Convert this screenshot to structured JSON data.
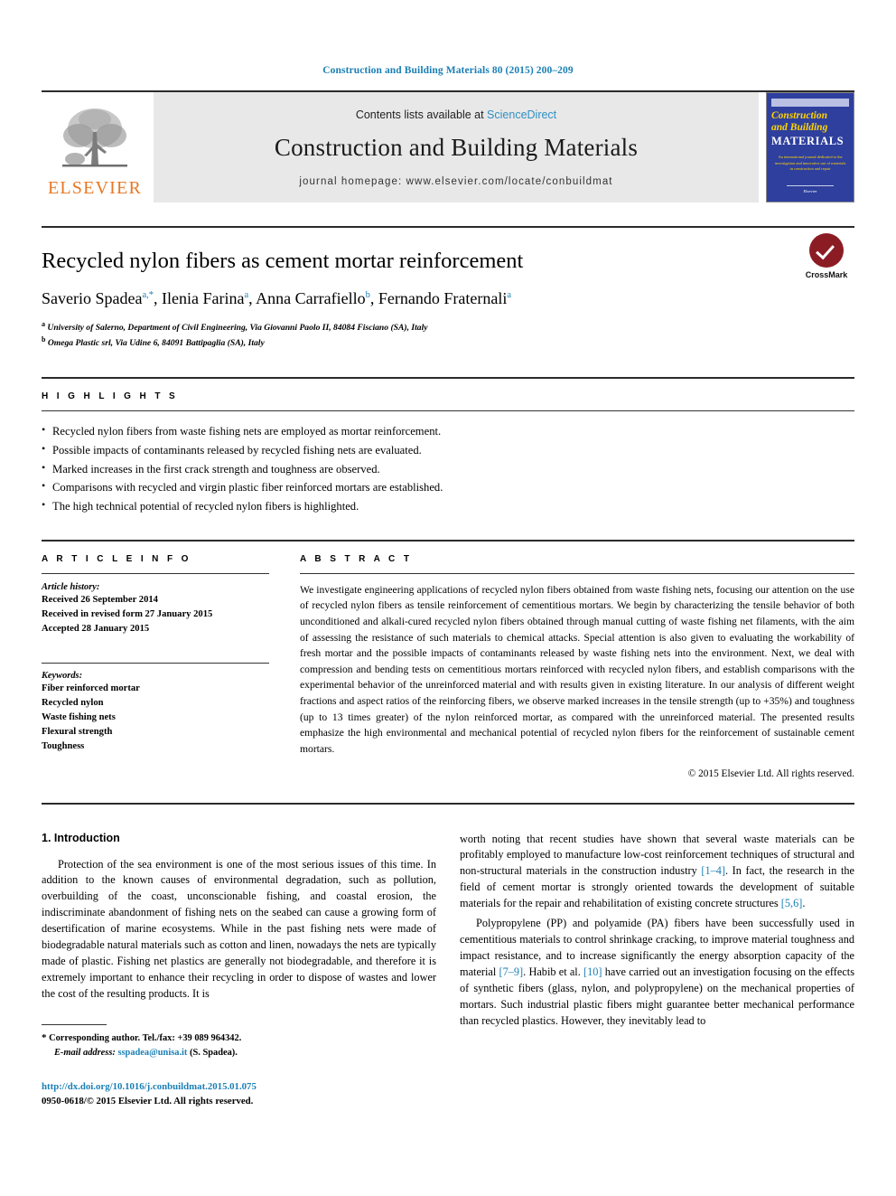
{
  "running_head": "Construction and Building Materials 80 (2015) 200–209",
  "masthead": {
    "contents_prefix": "Contents lists available at ",
    "sciencedirect": "ScienceDirect",
    "journal_title": "Construction and Building Materials",
    "homepage": "journal homepage: www.elsevier.com/locate/conbuildmat",
    "publisher_wordmark": "ELSEVIER",
    "publisher_logo_icon": "elsevier-tree-icon",
    "cover": {
      "line1": "Construction",
      "line2": "and Building",
      "line3": "MATERIALS",
      "blurb": "An international journal dedicated to the investigation and innovative use of materials in construction and repair",
      "foot": "Elsevier"
    },
    "colors": {
      "accent_blue": "#1a7fb5",
      "elsevier_orange": "#E87722",
      "cover_blue": "#2e3f9e",
      "cover_yellow": "#ffd400"
    }
  },
  "article": {
    "title": "Recycled nylon fibers as cement mortar reinforcement",
    "authors": [
      {
        "name": "Saverio Spadea",
        "marks": "a,*"
      },
      {
        "name": "Ilenia Farina",
        "marks": "a"
      },
      {
        "name": "Anna Carrafiello",
        "marks": "b"
      },
      {
        "name": "Fernando Fraternali",
        "marks": "a"
      }
    ],
    "affiliations": [
      {
        "mark": "a",
        "text": "University of Salerno, Department of Civil Engineering, Via Giovanni Paolo II, 84084 Fisciano (SA), Italy"
      },
      {
        "mark": "b",
        "text": "Omega Plastic srl, Via Udine 6, 84091 Battipaglia (SA), Italy"
      }
    ],
    "crossmark_label": "CrossMark"
  },
  "highlights": {
    "heading": "H I G H L I G H T S",
    "items": [
      "Recycled nylon fibers from waste fishing nets are employed as mortar reinforcement.",
      "Possible impacts of contaminants released by recycled fishing nets are evaluated.",
      "Marked increases in the first crack strength and toughness are observed.",
      "Comparisons with recycled and virgin plastic fiber reinforced mortars are established.",
      "The high technical potential of recycled nylon fibers is highlighted."
    ]
  },
  "article_info": {
    "heading": "A R T I C L E   I N F O",
    "history_label": "Article history:",
    "history": [
      "Received 26 September 2014",
      "Received in revised form 27 January 2015",
      "Accepted 28 January 2015"
    ],
    "keywords_label": "Keywords:",
    "keywords": [
      "Fiber reinforced mortar",
      "Recycled nylon",
      "Waste fishing nets",
      "Flexural strength",
      "Toughness"
    ]
  },
  "abstract": {
    "heading": "A B S T R A C T",
    "text": "We investigate engineering applications of recycled nylon fibers obtained from waste fishing nets, focusing our attention on the use of recycled nylon fibers as tensile reinforcement of cementitious mortars. We begin by characterizing the tensile behavior of both unconditioned and alkali-cured recycled nylon fibers obtained through manual cutting of waste fishing net filaments, with the aim of assessing the resistance of such materials to chemical attacks. Special attention is also given to evaluating the workability of fresh mortar and the possible impacts of contaminants released by waste fishing nets into the environment. Next, we deal with compression and bending tests on cementitious mortars reinforced with recycled nylon fibers, and establish comparisons with the experimental behavior of the unreinforced material and with results given in existing literature. In our analysis of different weight fractions and aspect ratios of the reinforcing fibers, we observe marked increases in the tensile strength (up to +35%) and toughness (up to 13 times greater) of the nylon reinforced mortar, as compared with the unreinforced material. The presented results emphasize the high environmental and mechanical potential of recycled nylon fibers for the reinforcement of sustainable cement mortars.",
    "copyright": "© 2015 Elsevier Ltd. All rights reserved."
  },
  "body": {
    "section_title": "1. Introduction",
    "left_paragraphs": [
      "Protection of the sea environment is one of the most serious issues of this time. In addition to the known causes of environmental degradation, such as pollution, overbuilding of the coast, unconscionable fishing, and coastal erosion, the indiscriminate abandonment of fishing nets on the seabed can cause a growing form of desertification of marine ecosystems. While in the past fishing nets were made of biodegradable natural materials such as cotton and linen, nowadays the nets are typically made of plastic. Fishing net plastics are generally not biodegradable, and therefore it is extremely important to enhance their recycling in order to dispose of wastes and lower the cost of the resulting products. It is"
    ],
    "right_paragraph_1_part1": "worth noting that recent studies have shown that several waste materials can be profitably employed to manufacture low-cost reinforcement techniques of structural and non-structural materials in the construction industry ",
    "right_cite_1": "[1–4]",
    "right_paragraph_1_part2": ". In fact, the research in the field of cement mortar is strongly oriented towards the development of suitable materials for the repair and rehabilitation of existing concrete structures ",
    "right_cite_2": "[5,6]",
    "right_paragraph_1_part3": ".",
    "right_paragraph_2_part1": "Polypropylene (PP) and polyamide (PA) fibers have been successfully used in cementitious materials to control shrinkage cracking, to improve material toughness and impact resistance, and to increase significantly the energy absorption capacity of the material ",
    "right_cite_3": "[7–9]",
    "right_paragraph_2_part2": ". Habib et al. ",
    "right_cite_4": "[10]",
    "right_paragraph_2_part3": " have carried out an investigation focusing on the effects of synthetic fibers (glass, nylon, and polypropylene) on the mechanical properties of mortars. Such industrial plastic fibers might guarantee better mechanical performance than recycled plastics. However, they inevitably lead to"
  },
  "footnotes": {
    "corresponding_marker": "*",
    "corresponding": "Corresponding author. Tel./fax: +39 089 964342.",
    "email_label": "E-mail address:",
    "email": "sspadea@unisa.it",
    "email_suffix": "(S. Spadea).",
    "doi": "http://dx.doi.org/10.1016/j.conbuildmat.2015.01.075",
    "issn": "0950-0618/© 2015 Elsevier Ltd. All rights reserved."
  }
}
